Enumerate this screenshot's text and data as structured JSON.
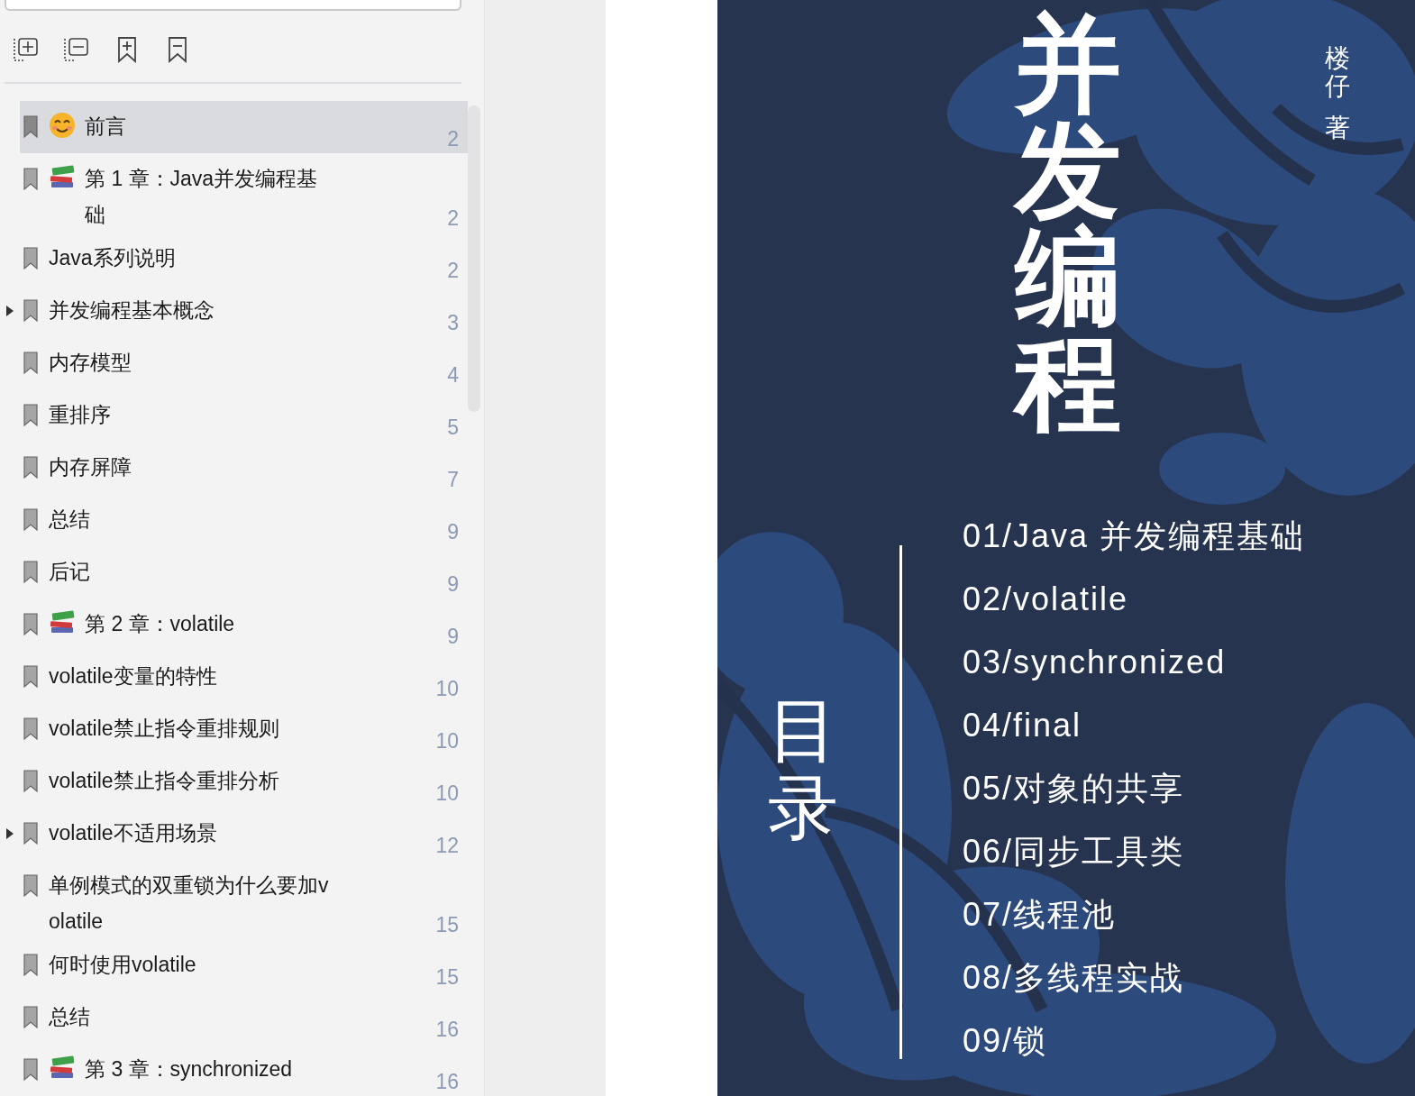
{
  "sidebar": {
    "toolbar": [
      {
        "kind": "expand"
      },
      {
        "kind": "collapse"
      },
      {
        "kind": "add-bookmark"
      },
      {
        "kind": "remove-bookmark"
      }
    ],
    "bookmarks": [
      {
        "label": "前言",
        "kind": "smile",
        "page": "2",
        "selected": true
      },
      {
        "label": "第 1 章：Java并发编程基础",
        "kind": "books",
        "page": "2",
        "selected": false
      },
      {
        "label": "Java系列说明",
        "kind": "plain",
        "page": "2",
        "selected": false
      },
      {
        "label": "并发编程基本概念",
        "kind": "plain",
        "page": "3",
        "selected": false,
        "expanded": false
      },
      {
        "label": "内存模型",
        "kind": "plain",
        "page": "4",
        "selected": false
      },
      {
        "label": "重排序",
        "kind": "plain",
        "page": "5",
        "selected": false
      },
      {
        "label": "内存屏障",
        "kind": "plain",
        "page": "7",
        "selected": false
      },
      {
        "label": "总结",
        "kind": "plain",
        "page": "9",
        "selected": false
      },
      {
        "label": "后记",
        "kind": "plain",
        "page": "9",
        "selected": false
      },
      {
        "label": "第 2 章：volatile",
        "kind": "books",
        "page": "9",
        "selected": false
      },
      {
        "label": "volatile变量的特性",
        "kind": "plain",
        "page": "10",
        "selected": false
      },
      {
        "label": "volatile禁止指令重排规则",
        "kind": "plain",
        "page": "10",
        "selected": false
      },
      {
        "label": "volatile禁止指令重排分析",
        "kind": "plain",
        "page": "10",
        "selected": false
      },
      {
        "label": "volatile不适用场景",
        "kind": "plain",
        "page": "12",
        "selected": false,
        "expanded": false
      },
      {
        "label": "单例模式的双重锁为什么要加volatile",
        "kind": "plain",
        "page": "15",
        "selected": false
      },
      {
        "label": "何时使用volatile",
        "kind": "plain",
        "page": "15",
        "selected": false
      },
      {
        "label": "总结",
        "kind": "plain",
        "page": "16",
        "selected": false
      },
      {
        "label": "第 3 章：synchronized",
        "kind": "books",
        "page": "16",
        "selected": false
      }
    ]
  },
  "page": {
    "title": "并发编程",
    "author": "楼仔",
    "author_suffix": "著",
    "toc_heading": "目录",
    "toc": [
      "01/Java 并发编程基础",
      "02/volatile",
      "03/synchronized",
      "04/final",
      "05/对象的共享",
      "06/同步工具类",
      "07/线程池",
      "08/多线程实战",
      "09/锁"
    ]
  }
}
